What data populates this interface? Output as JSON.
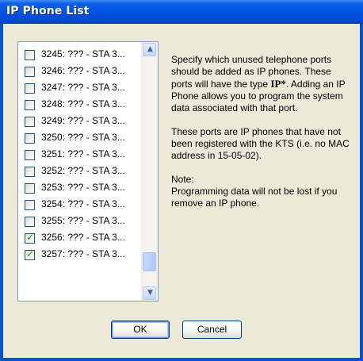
{
  "window": {
    "title": "IP Phone List"
  },
  "list": {
    "items": [
      {
        "label": "3245: ??? - STA 3...",
        "checked": false
      },
      {
        "label": "3246: ??? - STA 3...",
        "checked": false
      },
      {
        "label": "3247: ??? - STA 3...",
        "checked": false
      },
      {
        "label": "3248: ??? - STA 3...",
        "checked": false
      },
      {
        "label": "3249: ??? - STA 3...",
        "checked": false
      },
      {
        "label": "3250: ??? - STA 3...",
        "checked": false
      },
      {
        "label": "3251: ??? - STA 3...",
        "checked": false
      },
      {
        "label": "3252: ??? - STA 3...",
        "checked": false
      },
      {
        "label": "3253: ??? - STA 3...",
        "checked": false
      },
      {
        "label": "3254: ??? - STA 3...",
        "checked": false
      },
      {
        "label": "3255: ??? - STA 3...",
        "checked": false
      },
      {
        "label": "3256: ??? - STA 3...",
        "checked": true
      },
      {
        "label": "3257: ??? - STA 3...",
        "checked": true
      }
    ],
    "scroll_position": 0.93
  },
  "description": {
    "para1_before": "Specify which unused telephone ports should be added as IP phones. These ports will have the type ",
    "para1_bold": "IP*",
    "para1_after": ". Adding an IP Phone allows you to program the system data associated with that port.",
    "para2": "These ports are IP phones that have not been registered with the KTS (i.e. no MAC address in 15-05-02).",
    "note_label": "Note:",
    "note_text": "Programming data will not be lost if you remove an IP phone."
  },
  "buttons": {
    "ok_label": "OK",
    "cancel_label": "Cancel"
  },
  "colors": {
    "titlebar": "#0055e5",
    "client_bg": "#ece9d8",
    "check": "#21a121"
  }
}
